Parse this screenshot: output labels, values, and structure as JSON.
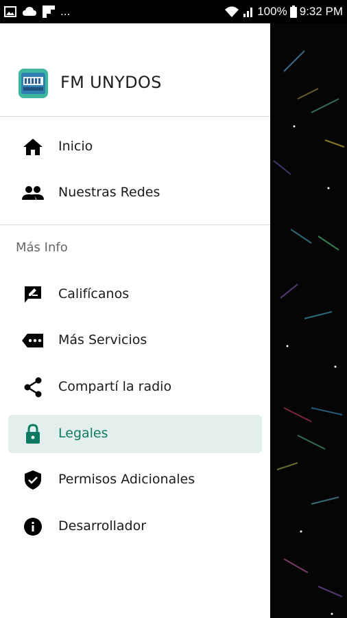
{
  "status_bar": {
    "overflow_dots": "...",
    "battery": "100%",
    "time": "9:32 PM"
  },
  "drawer": {
    "app_title": "FM UNYDOS",
    "items_top": [
      {
        "label": "Inicio",
        "icon": "home-icon"
      },
      {
        "label": "Nuestras Redes",
        "icon": "people-icon"
      }
    ],
    "section_title": "Más Info",
    "items_more": [
      {
        "label": "Califícanos",
        "icon": "rate-review-icon"
      },
      {
        "label": "Más Servicios",
        "icon": "more-tag-icon"
      },
      {
        "label": "Compartí la radio",
        "icon": "share-icon"
      },
      {
        "label": "Legales",
        "icon": "lock-icon",
        "active": true
      },
      {
        "label": "Permisos Adicionales",
        "icon": "verified-shield-icon"
      },
      {
        "label": "Desarrollador",
        "icon": "info-icon"
      }
    ]
  },
  "colors": {
    "active_bg": "#e2efec",
    "active_text": "#0f7a63",
    "logo_accent": "#3cb7a0"
  }
}
